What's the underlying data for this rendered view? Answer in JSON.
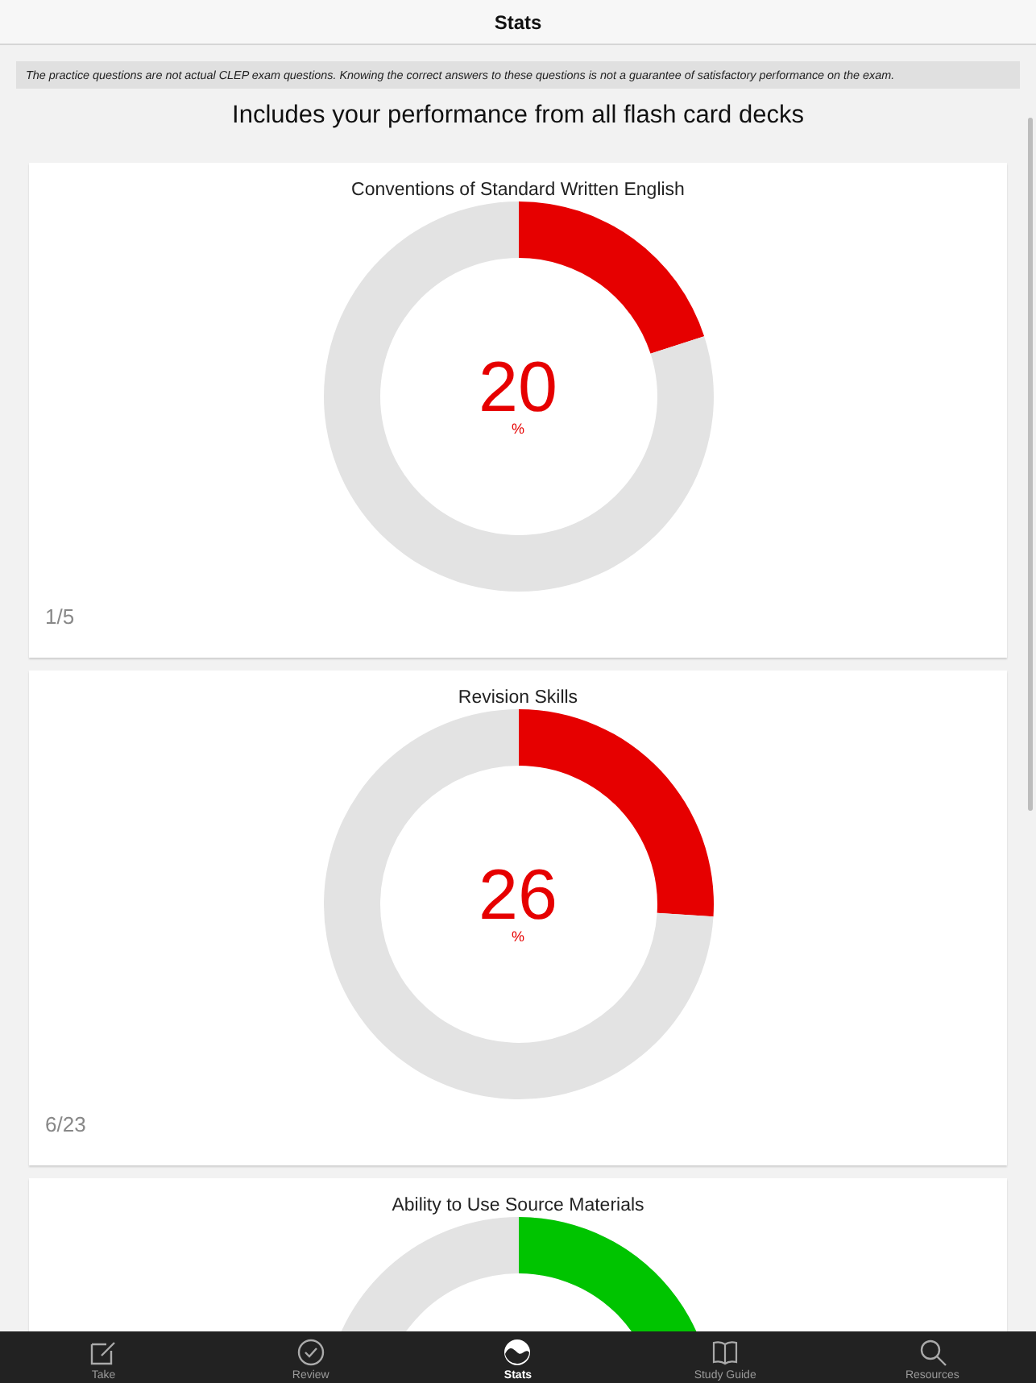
{
  "nav": {
    "title": "Stats"
  },
  "disclaimer": "The practice questions are not actual CLEP exam questions. Knowing the correct answers to these questions is not a guarantee of satisfactory performance on the exam.",
  "heading": "Includes your performance from all flash card decks",
  "cards": [
    {
      "title": "Conventions of Standard Written English",
      "color": "#e60000",
      "chart_data": {
        "type": "donut",
        "values": [
          20,
          80
        ]
      },
      "percent": "20",
      "unit": "%",
      "count": "1/5"
    },
    {
      "title": "Revision Skills",
      "color": "#e60000",
      "chart_data": {
        "type": "donut",
        "values": [
          26,
          74
        ]
      },
      "percent": "26",
      "unit": "%",
      "count": "6/23"
    },
    {
      "title": "Ability to Use Source Materials",
      "color": "#00c400"
    }
  ],
  "tabs": [
    {
      "kind": "take",
      "label": "Take",
      "selected": false
    },
    {
      "kind": "review",
      "label": "Review",
      "selected": false
    },
    {
      "kind": "stats",
      "label": "Stats",
      "selected": true
    },
    {
      "kind": "guide",
      "label": "Study Guide",
      "selected": false
    },
    {
      "kind": "resources",
      "label": "Resources",
      "selected": false
    }
  ]
}
